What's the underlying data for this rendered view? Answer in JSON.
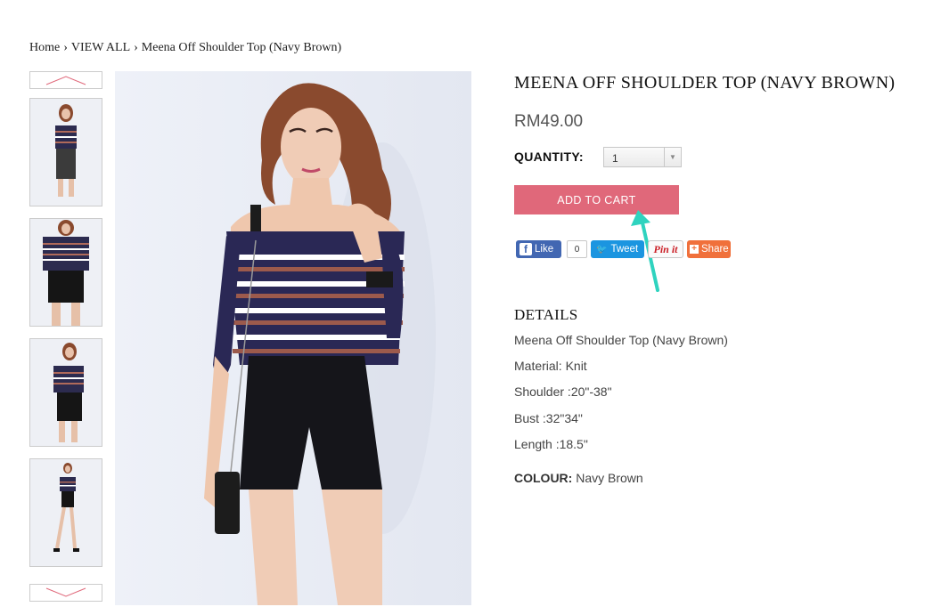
{
  "breadcrumb": {
    "home": "Home",
    "separator": "›",
    "category": "VIEW ALL",
    "current": "Meena Off Shoulder Top (Navy Brown)"
  },
  "gallery": {
    "up_icon": "chevron-up-icon",
    "down_icon": "chevron-down-icon",
    "thumbnail_count": 4,
    "thumbnails": [
      {
        "name": "thumbnail-1"
      },
      {
        "name": "thumbnail-2"
      },
      {
        "name": "thumbnail-3"
      },
      {
        "name": "thumbnail-4"
      }
    ]
  },
  "product": {
    "title": "MEENA OFF SHOULDER TOP (NAVY BROWN)",
    "price": "RM49.00",
    "quantity_label": "QUANTITY:",
    "quantity_value": "1",
    "add_to_cart": "ADD TO CART"
  },
  "social": {
    "like_label": "Like",
    "like_count": "0",
    "tweet_label": "Tweet",
    "pinit_label": "Pin it",
    "share_label": "Share"
  },
  "details": {
    "heading": "DETAILS",
    "lines": [
      "Meena Off Shoulder Top (Navy Brown)",
      "Material: Knit",
      "Shoulder :20\"-38\"",
      "Bust :32\"34\"",
      "Length :18.5\""
    ],
    "colour_label": "COLOUR:",
    "colour_value": "Navy Brown"
  },
  "colors": {
    "add_to_cart_bg": "#e0687a",
    "facebook": "#4267b2",
    "twitter": "#1b95e0",
    "pinterest": "#cb2027",
    "share": "#f0703b",
    "annotation_arrow": "#2fd3bf",
    "thumb_arrow": "#e0687a"
  }
}
